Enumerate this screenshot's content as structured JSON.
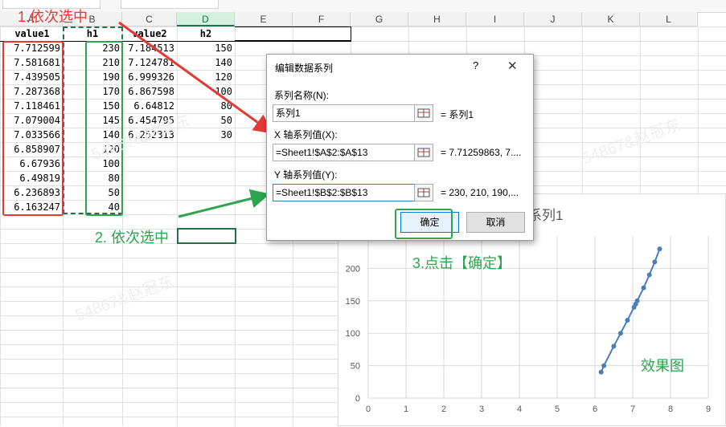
{
  "columns": [
    "A",
    "B",
    "C",
    "D",
    "E",
    "F",
    "G",
    "H",
    "I",
    "J",
    "K",
    "L"
  ],
  "sheet": {
    "headers": [
      "value1",
      "h1",
      "value2",
      "h2"
    ],
    "value1": [
      "7.712599",
      "7.581681",
      "7.439505",
      "7.287368",
      "7.118461",
      "7.079004",
      "7.033566",
      "6.858907",
      "6.67936",
      "6.49819",
      "6.236893",
      "6.163247"
    ],
    "h1": [
      "230",
      "210",
      "190",
      "170",
      "150",
      "145",
      "140",
      "120",
      "100",
      "80",
      "50",
      "40"
    ],
    "value2": [
      "7.184513",
      "7.124781",
      "6.999326",
      "6.867598",
      "6.64812",
      "6.454795",
      "6.252313"
    ],
    "h2": [
      "150",
      "140",
      "120",
      "100",
      "80",
      "50",
      "30"
    ]
  },
  "annotations": {
    "step1": "1.依次选中",
    "step2": "2. 依次选中",
    "step3": "3.点击【确定】",
    "result": "效果图"
  },
  "dialog": {
    "title": "编辑数据系列",
    "help": "?",
    "close": "✕",
    "name_label": "系列名称(N):",
    "name_value": "系列1",
    "name_preview": "= 系列1",
    "x_label": "X 轴系列值(X):",
    "x_value": "=Sheet1!$A$2:$A$13",
    "x_preview": "= 7.71259863, 7....",
    "y_label": "Y 轴系列值(Y):",
    "y_value": "=Sheet1!$B$2:$B$13",
    "y_preview": "= 230, 210, 190,...",
    "ok": "确定",
    "cancel": "取消"
  },
  "chart_data": {
    "type": "scatter",
    "title": "系列1",
    "x_ticks": [
      "0",
      "1",
      "2",
      "3",
      "4",
      "5",
      "6",
      "7",
      "8",
      "9"
    ],
    "y_ticks": [
      "0",
      "50",
      "100",
      "150",
      "200"
    ],
    "xlim": [
      0,
      9
    ],
    "ylim": [
      0,
      250
    ],
    "series": [
      {
        "name": "系列1",
        "color": "#4a7ebb",
        "x": [
          7.712599,
          7.581681,
          7.439505,
          7.287368,
          7.118461,
          7.079004,
          7.033566,
          6.858907,
          6.67936,
          6.49819,
          6.236893,
          6.163247
        ],
        "y": [
          230,
          210,
          190,
          170,
          150,
          145,
          140,
          120,
          100,
          80,
          50,
          40
        ]
      }
    ]
  },
  "watermark": "54867&赵冠东"
}
